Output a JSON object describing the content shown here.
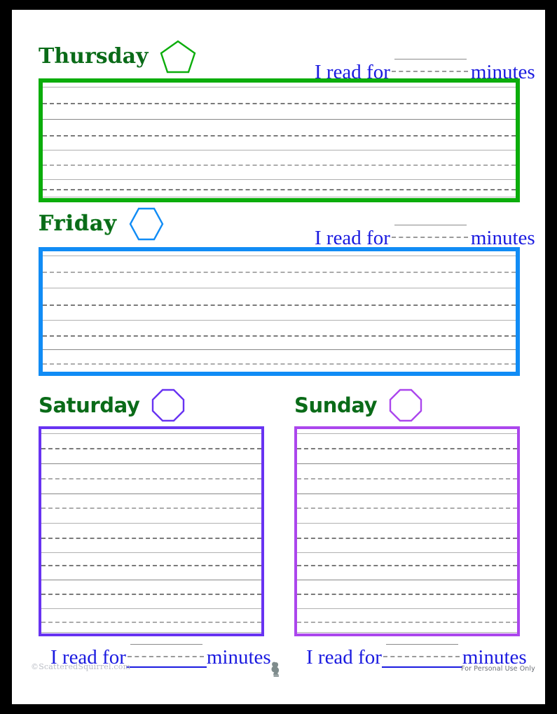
{
  "page": {
    "frame_color": "#000000",
    "sheet_color": "#ffffff",
    "title_color": "#0a6b18",
    "blank_text_color": "#1a1ae0"
  },
  "days": [
    {
      "id": "thursday",
      "label": "Thursday",
      "shape": "pentagon-icon",
      "shape_sides": 5,
      "accent_color": "#0bad0b",
      "solid_rules": 5,
      "dashed_rules": 4,
      "read_prefix": "I read for",
      "read_suffix": "minutes",
      "read_value": ""
    },
    {
      "id": "friday",
      "label": "Friday",
      "shape": "hexagon-icon",
      "shape_sides": 6,
      "accent_color": "#118cf5",
      "solid_rules": 5,
      "dashed_rules": 4,
      "read_prefix": "I read for",
      "read_suffix": "minutes",
      "read_value": ""
    },
    {
      "id": "saturday",
      "label": "Saturday",
      "shape": "octagon-icon",
      "shape_sides": 8,
      "accent_color": "#6833f2",
      "solid_rules": 8,
      "dashed_rules": 7,
      "read_prefix": "I read for",
      "read_suffix": "minutes",
      "read_value": ""
    },
    {
      "id": "sunday",
      "label": "Sunday",
      "shape": "octagon-icon",
      "shape_sides": 8,
      "accent_color": "#ab46ed",
      "solid_rules": 8,
      "dashed_rules": 7,
      "read_prefix": "I read for",
      "read_suffix": "minutes",
      "read_value": ""
    }
  ],
  "footer": {
    "copyright": "©ScatteredSquirrel.com",
    "personal_use": "For Personal Use Only",
    "logo": "squirrel-icon"
  }
}
